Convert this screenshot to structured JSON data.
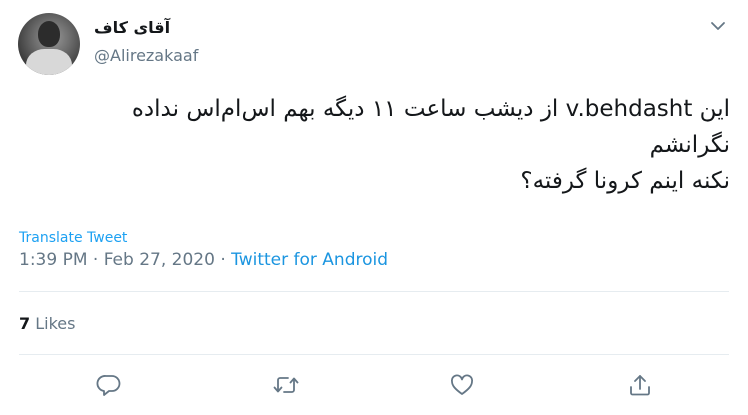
{
  "user": {
    "display_name": "آقای کاف",
    "handle": "@Alirezakaaf"
  },
  "tweet": {
    "lines": [
      "این v.behdasht از دیشب ساعت ۱۱ دیگه بهم اس‌ام‌اس نداده",
      "نگرانشم",
      "نکنه اینم کرونا گرفته؟"
    ],
    "translate_label": "Translate Tweet",
    "timestamp": "1:39 PM · Feb 27, 2020 · ",
    "source": "Twitter for Android"
  },
  "stats": {
    "likes_count": "7",
    "likes_label": " Likes"
  },
  "actions": {
    "icons": [
      "reply-icon",
      "retweet-icon",
      "like-icon",
      "share-icon"
    ]
  },
  "colors": {
    "link": "#1da1f2",
    "muted": "#657786",
    "text": "#14171a",
    "divider": "#e6ecf0"
  }
}
